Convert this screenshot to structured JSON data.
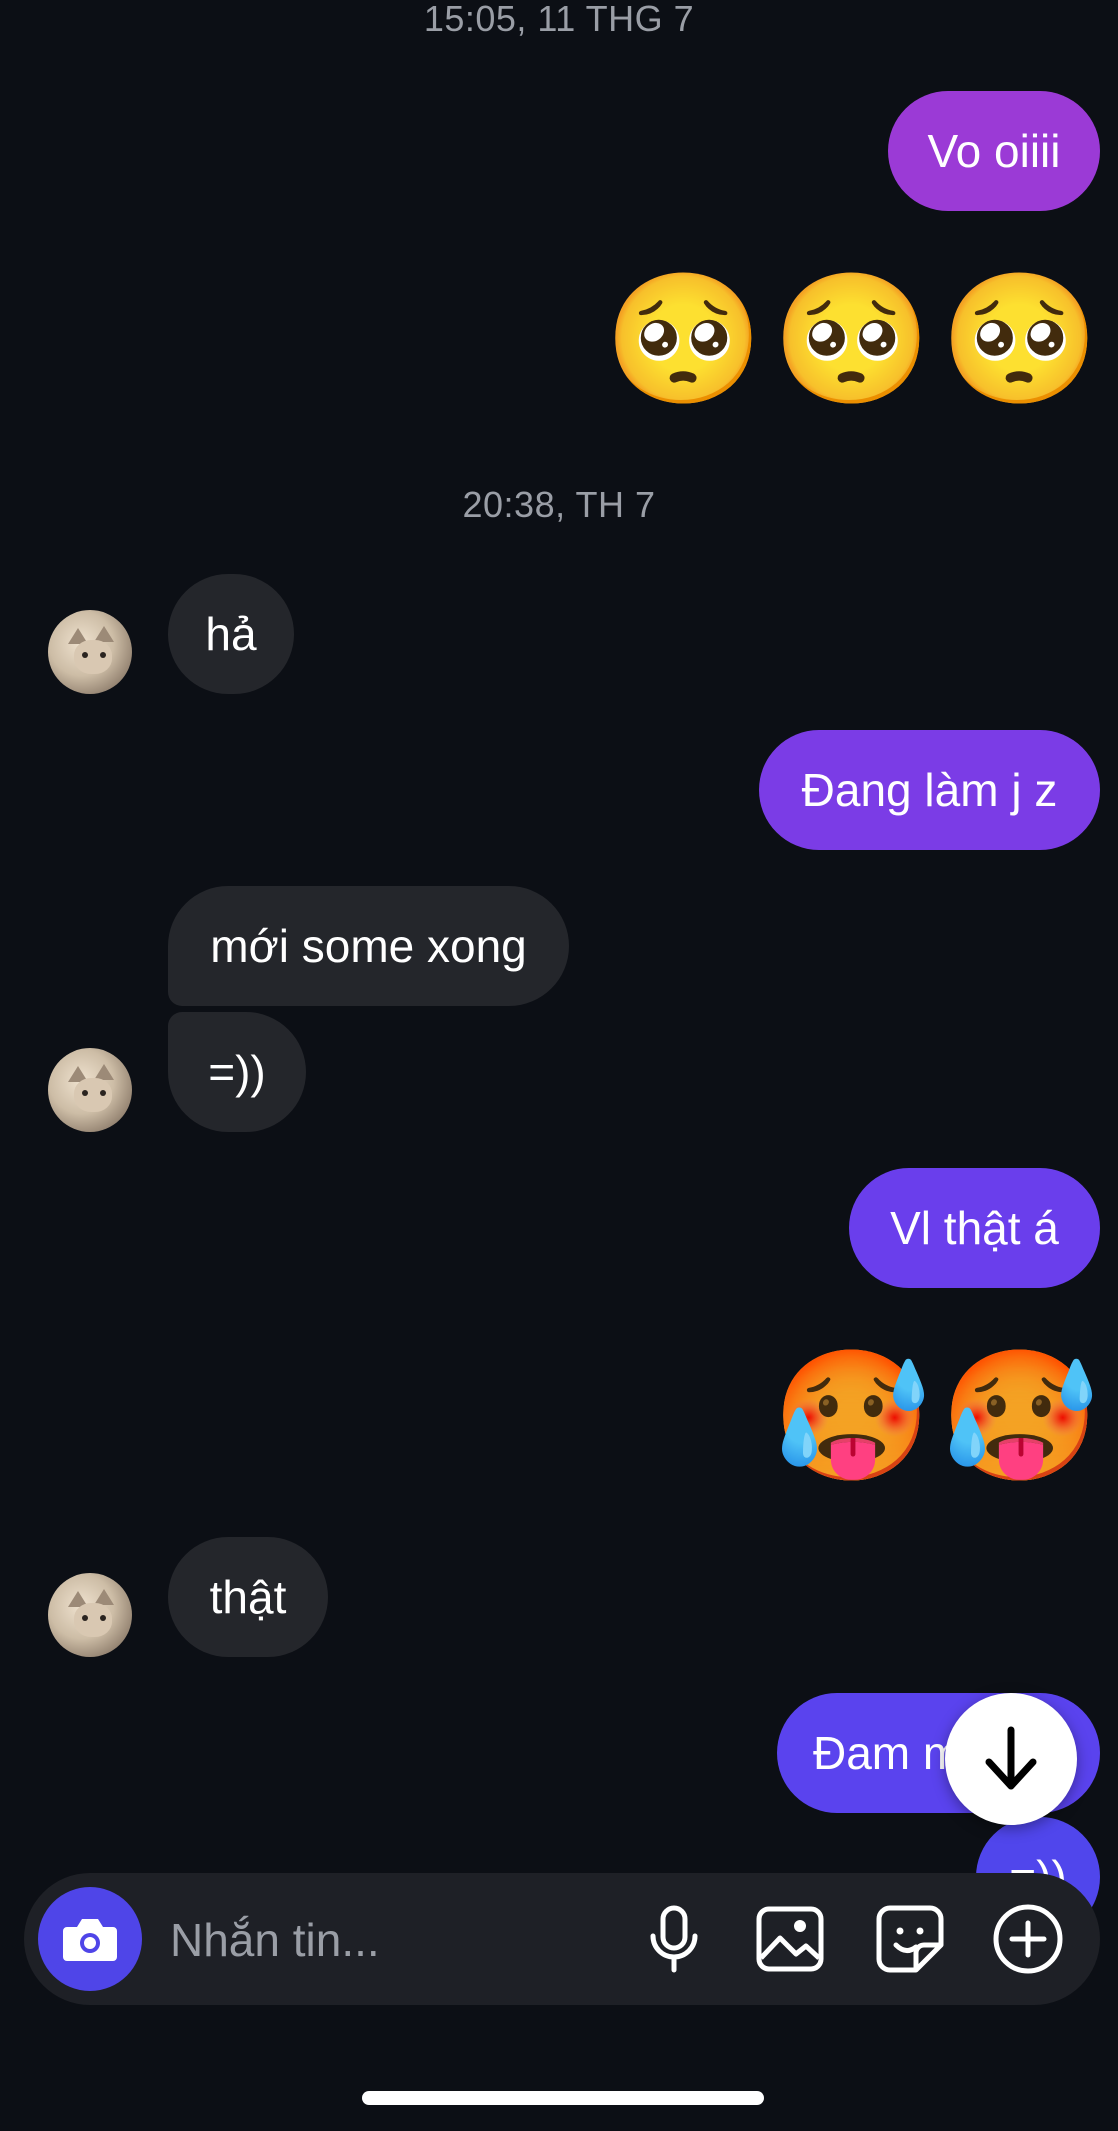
{
  "timestamps": [
    "15:05, 11 THG 7",
    "20:38, TH 7"
  ],
  "messages": {
    "out_1": "Vo oiiii",
    "in_1": "hả",
    "out_2": "Đang làm j z",
    "in_2": "mới some xong",
    "in_3": "=))",
    "out_3": "Vl thật á",
    "in_4": "thật",
    "out_4": "Đam m",
    "out_5": "=))"
  },
  "emoji_rows": {
    "pleading": [
      "🥺",
      "🥺",
      "🥺"
    ],
    "hot": [
      "🥵",
      "🥵"
    ]
  },
  "composer": {
    "placeholder": "Nhắn tin...",
    "icons": [
      "camera-icon",
      "microphone-icon",
      "gallery-icon",
      "sticker-icon",
      "plus-icon"
    ]
  },
  "colors": {
    "background": "#0c0f15",
    "incoming_bubble": "#24262b",
    "outgoing_gradient": [
      "#9b3ad6",
      "#4f45e8"
    ],
    "scroll_button": "#ffffff"
  },
  "scroll_button_icon": "arrow-down-icon"
}
